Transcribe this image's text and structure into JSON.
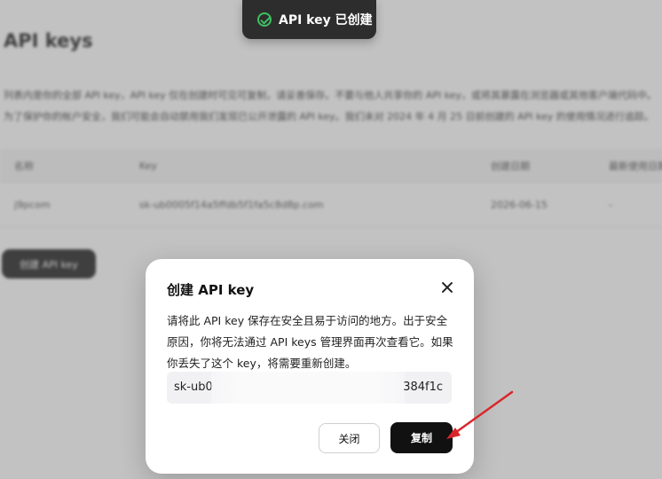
{
  "toast": {
    "message": "API key 已创建",
    "icon": "check-circle-icon"
  },
  "background": {
    "title": "API keys",
    "description_line1": "列表内是你的全部 API key，API key 仅在创建时可见可复制，请妥善保存。不要与他人共享你的 API key，或将其暴露在浏览器或其他客户端代码中。",
    "description_line2": "为了保护你的帐户安全，我们可能会自动禁用我们发现已公开泄露的 API key。我们未对 2024 年 4 月 25 日前创建的 API key 的使用情况进行追踪。",
    "table": {
      "headers": [
        "名称",
        "Key",
        "创建日期",
        "最新使用日期"
      ],
      "rows": [
        [
          "j9pcom",
          "sk-ub0005f14a5ffdb5f1fa5c8d8p.com",
          "2026-06-15",
          "-"
        ]
      ]
    },
    "create_button_label": "创建 API key"
  },
  "modal": {
    "title": "创建 API key",
    "body": "请将此 API key 保存在安全且易于访问的地方。出于安全原因，你将无法通过 API keys 管理界面再次查看它。如果你丢失了这个 key，将需要重新创建。",
    "key_prefix": "sk-ub0",
    "key_suffix": "384f1c",
    "close_button_label": "关闭",
    "copy_button_label": "复制"
  },
  "colors": {
    "accent": "#111111",
    "success": "#3fbf62",
    "annotation_arrow": "#d9262b"
  }
}
